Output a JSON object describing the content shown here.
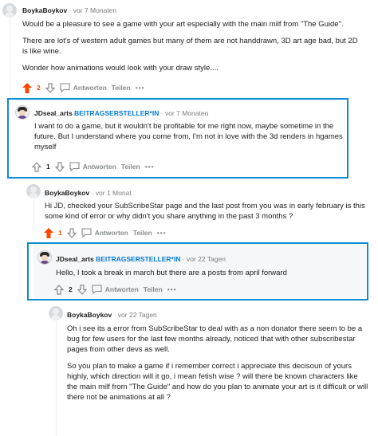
{
  "comments": [
    {
      "author": "BoykaBoykov",
      "time": "vor 7 Monaten",
      "paragraphs": [
        "Would be a pleasure to see a game with your art especially with the main milf from \"The Guide\".",
        "There are lot's of western adult games but many of them are not handdrawn, 3D art age bad, but 2D is like wine.",
        "Wonder how animations would look with your draw style...."
      ],
      "score": "2",
      "reply_label": "Antworten",
      "share_label": "Teilen"
    },
    {
      "author": "JDseal_arts",
      "badge": "BEITRAGSERSTELLER*IN",
      "time": "vor 7 Monaten",
      "paragraphs": [
        "I want to do a game, but it wouldn't be profitable for me right now, maybe sometime in the future. But I understand where you come from, I'm not in love with the 3d renders in hgames myself"
      ],
      "score": "1",
      "reply_label": "Antworten",
      "share_label": "Teilen"
    },
    {
      "author": "BoykaBoykov",
      "time": "vor 1 Monat",
      "paragraphs": [
        "Hi JD, checked your SubScribeStar page and the last post from you was in early february is this some kind of error or why didn't you share anything in the past 3 months ?"
      ],
      "score": "1",
      "reply_label": "Antworten",
      "share_label": "Teilen"
    },
    {
      "author": "JDseal_arts",
      "badge": "BEITRAGSERSTELLER*IN",
      "time": "vor 22 Tagen",
      "paragraphs": [
        "Hello, I took a break in march but there are a posts from april forward"
      ],
      "score": "2",
      "reply_label": "Antworten",
      "share_label": "Teilen"
    },
    {
      "author": "BoykaBoykov",
      "time": "vor 22 Tagen",
      "paragraphs": [
        "Oh i see its a error from SubScribeStar to deal with as a non donator there seem to be a bug for few users for the last few months already, noticed that with other subscribestar pages from other devs as well.",
        "So you plan to make a game if i remember correct i appreciate this decisoun of yours highly, which direction will it go, i mean fetish wise ? will there be known characters like the main milf from \"The Guide\" and how do you plan to animate your art is it difficult or will there not be animations at all ?"
      ]
    }
  ],
  "colors": {
    "upvote_active": "#ff4500",
    "highlight_border": "#0e8ccf",
    "op_badge": "#0079d3"
  }
}
